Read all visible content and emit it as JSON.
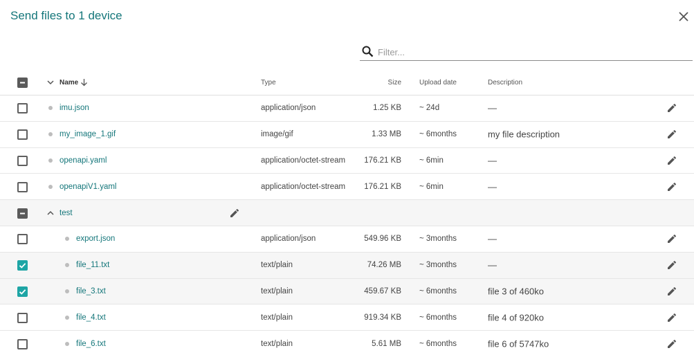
{
  "dialog": {
    "title": "Send files to 1 device"
  },
  "filter": {
    "placeholder": "Filter..."
  },
  "columns": {
    "name": "Name",
    "type": "Type",
    "size": "Size",
    "upload_date": "Upload date",
    "description": "Description"
  },
  "files": [
    {
      "name": "imu.json",
      "type": "application/json",
      "size": "1.25 KB",
      "date": "~ 24d",
      "description": "—",
      "checked": false
    },
    {
      "name": "my_image_1.gif",
      "type": "image/gif",
      "size": "1.33 MB",
      "date": "~ 6months",
      "description": "my file description",
      "checked": false
    },
    {
      "name": "openapi.yaml",
      "type": "application/octet-stream",
      "size": "176.21 KB",
      "date": "~ 6min",
      "description": "—",
      "checked": false
    },
    {
      "name": "openapiV1.yaml",
      "type": "application/octet-stream",
      "size": "176.21 KB",
      "date": "~ 6min",
      "description": "—",
      "checked": false
    }
  ],
  "folder": {
    "name": "test",
    "expanded": true,
    "state": "indeterminate"
  },
  "folder_files": [
    {
      "name": "export.json",
      "type": "application/json",
      "size": "549.96 KB",
      "date": "~ 3months",
      "description": "—",
      "checked": false
    },
    {
      "name": "file_11.txt",
      "type": "text/plain",
      "size": "74.26 MB",
      "date": "~ 3months",
      "description": "—",
      "checked": true
    },
    {
      "name": "file_3.txt",
      "type": "text/plain",
      "size": "459.67 KB",
      "date": "~ 6months",
      "description": "file 3 of 460ko",
      "checked": true
    },
    {
      "name": "file_4.txt",
      "type": "text/plain",
      "size": "919.34 KB",
      "date": "~ 6months",
      "description": "file 4 of 920ko",
      "checked": false
    },
    {
      "name": "file_6.txt",
      "type": "text/plain",
      "size": "5.61 MB",
      "date": "~ 6months",
      "description": "file 6 of 5747ko",
      "checked": false
    }
  ],
  "colors": {
    "accent": "#14767a",
    "checkbox_checked": "#1ea5a5",
    "checkbox_indeterminate": "#5a5a5a"
  }
}
